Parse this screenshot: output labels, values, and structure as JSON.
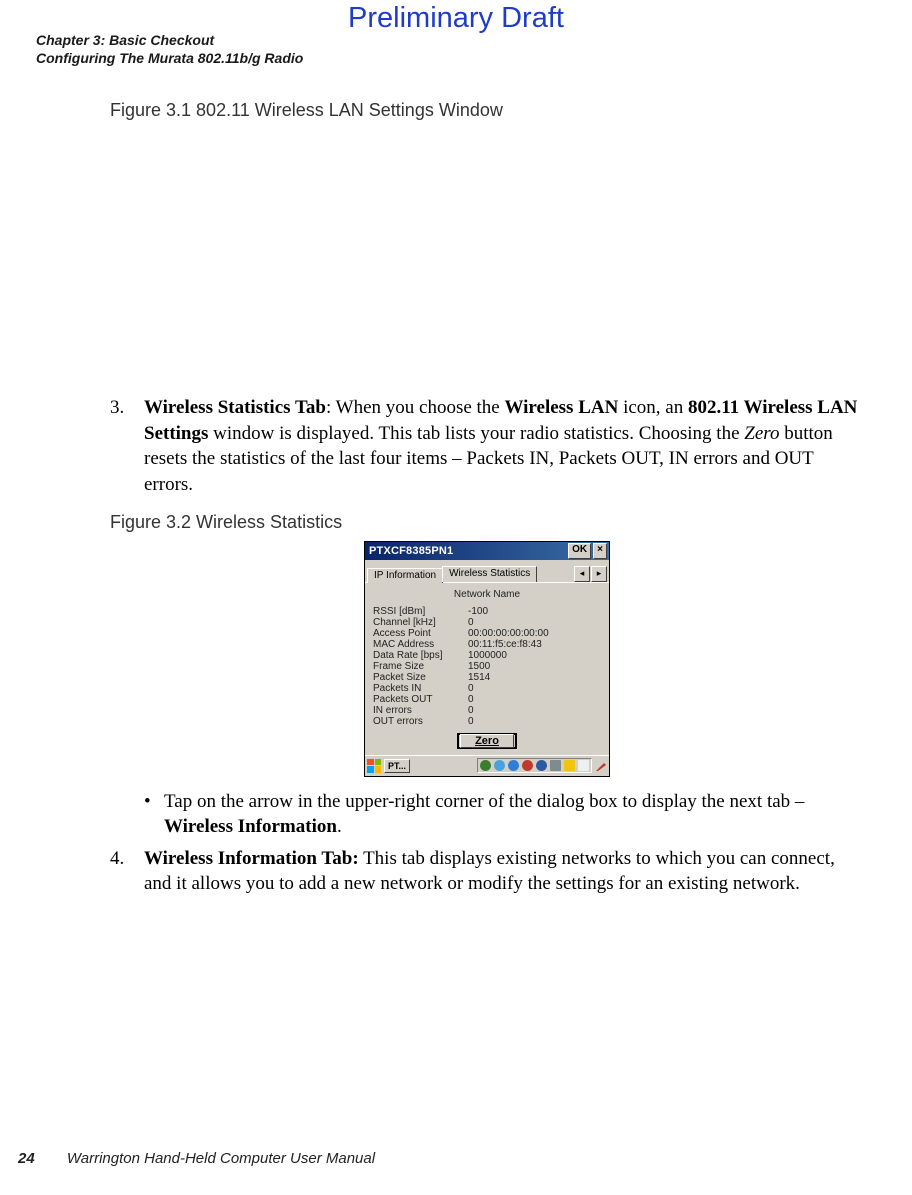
{
  "watermark": "Preliminary Draft",
  "header": {
    "line1": "Chapter 3: Basic Checkout",
    "line2": "Configuring The Murata 802.11b/g Radio"
  },
  "fig1_caption": "Figure 3.1  802.11 Wireless LAN Settings Window",
  "step3": {
    "num": "3.",
    "lead_bold": "Wireless Statistics Tab",
    "t1": ": When you choose the ",
    "b1": "Wireless LAN",
    "t2": " icon, an ",
    "b2": "802.11 Wireless LAN Settings",
    "t3": " window is displayed. This tab lists your radio statistics. Choosing the ",
    "i1": "Zero",
    "t4": " button resets the statistics of the last four items – Packets IN, Packets OUT, IN errors and OUT errors."
  },
  "fig2_caption": "Figure 3.2  Wireless Statistics",
  "dialog": {
    "title": "PTXCF8385PN1",
    "ok": "OK",
    "close": "×",
    "tab_inactive": "IP Information",
    "tab_active": "Wireless Statistics",
    "scroll_left": "◂",
    "scroll_right": "▸",
    "network_name_label": "Network Name",
    "stats": [
      {
        "label": "RSSI [dBm]",
        "value": "-100"
      },
      {
        "label": "Channel [kHz]",
        "value": "0"
      },
      {
        "label": "Access Point",
        "value": "00:00:00:00:00:00"
      },
      {
        "label": "MAC Address",
        "value": "00:11:f5:ce:f8:43"
      },
      {
        "label": "Data Rate [bps]",
        "value": "1000000"
      },
      {
        "label": "Frame Size",
        "value": "1500"
      },
      {
        "label": "Packet Size",
        "value": "1514"
      },
      {
        "label": "Packets IN",
        "value": "0"
      },
      {
        "label": "Packets OUT",
        "value": "0"
      },
      {
        "label": "IN errors",
        "value": "0"
      },
      {
        "label": "OUT errors",
        "value": "0"
      }
    ],
    "zero_label": "Zero",
    "task_btn": "PT..."
  },
  "bullet1": {
    "mark": "•",
    "t1": "Tap on the arrow in the upper-right corner of the dialog box to display the next tab – ",
    "b1": "Wireless Information",
    "t2": "."
  },
  "step4": {
    "num": "4.",
    "lead_bold": "Wireless Information Tab:",
    "t1": " This tab displays existing networks to which you can connect, and it allows you to add a new network or modify the settings for an existing network."
  },
  "footer": {
    "page": "24",
    "title": "Warrington Hand-Held Computer User Manual"
  }
}
